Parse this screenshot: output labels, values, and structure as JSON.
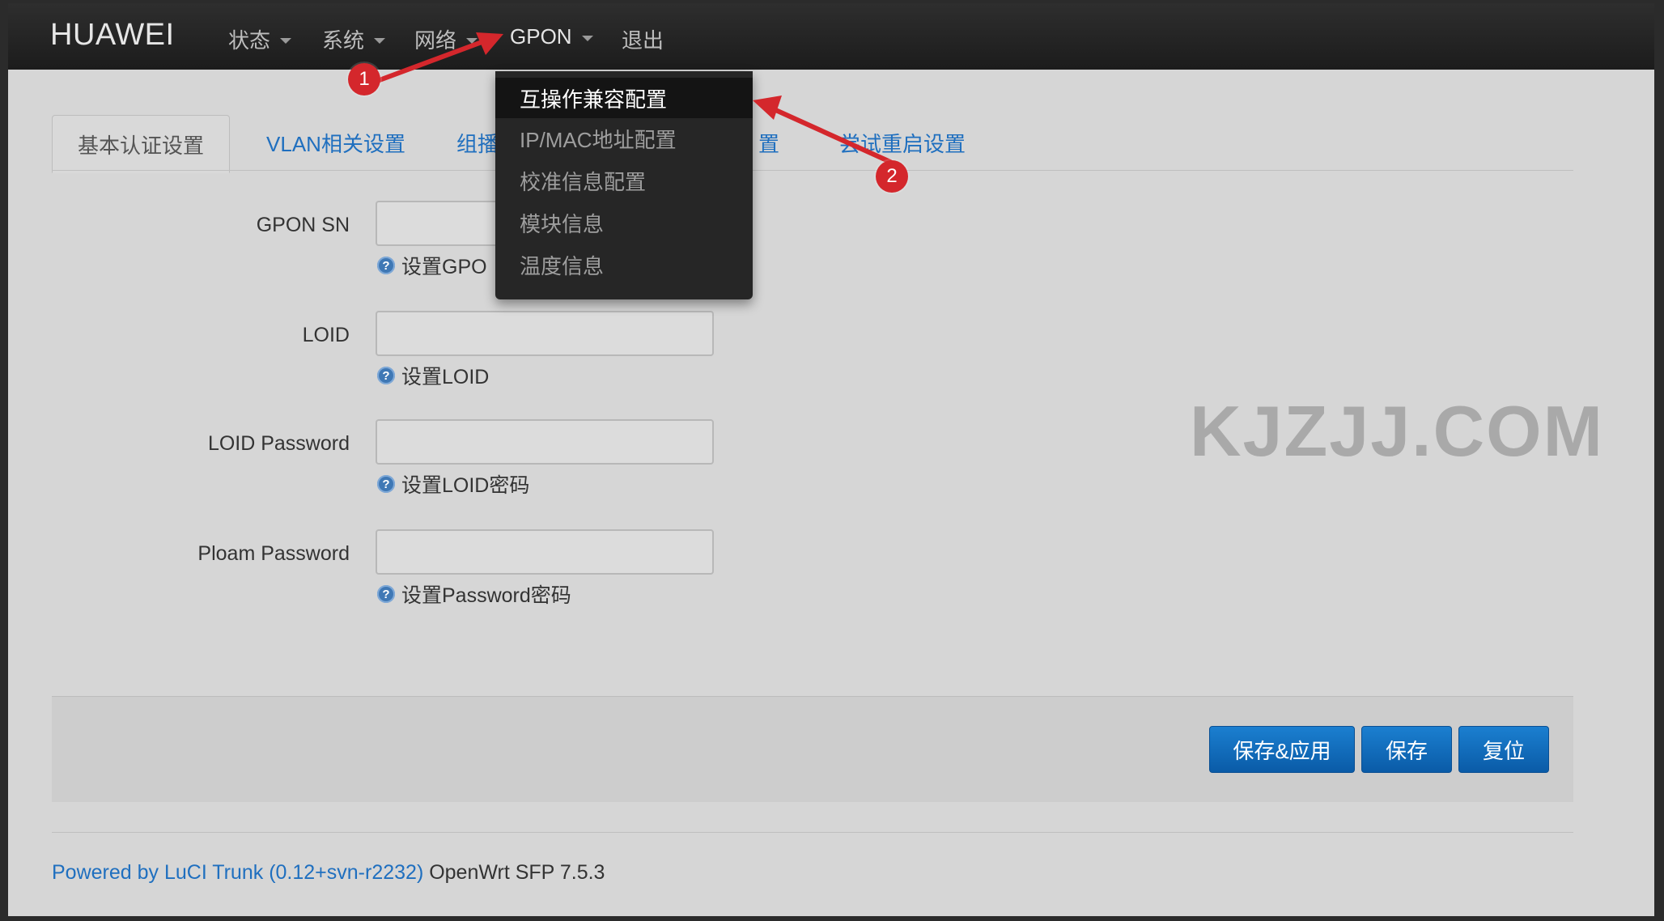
{
  "brand": "HUAWEI",
  "nav": {
    "items": [
      {
        "label": "状态"
      },
      {
        "label": "系统"
      },
      {
        "label": "网络"
      },
      {
        "label": "GPON"
      },
      {
        "label": "退出"
      }
    ]
  },
  "gpon_menu": {
    "items": [
      {
        "label": "互操作兼容配置"
      },
      {
        "label": "IP/MAC地址配置"
      },
      {
        "label": "校准信息配置"
      },
      {
        "label": "模块信息"
      },
      {
        "label": "温度信息"
      }
    ]
  },
  "tabs": [
    {
      "label": "基本认证设置"
    },
    {
      "label": "VLAN相关设置"
    },
    {
      "label": "组播"
    },
    {
      "label": "置"
    },
    {
      "label": "尝试重启设置"
    }
  ],
  "form": {
    "gpon_sn": {
      "label": "GPON SN",
      "value": "",
      "help": "设置GPO"
    },
    "loid": {
      "label": "LOID",
      "value": "",
      "help": "设置LOID"
    },
    "loid_password": {
      "label": "LOID Password",
      "value": "",
      "help": "设置LOID密码"
    },
    "ploam_password": {
      "label": "Ploam Password",
      "value": "",
      "help": "设置Password密码"
    }
  },
  "buttons": {
    "save_apply": "保存&应用",
    "save": "保存",
    "reset": "复位"
  },
  "footer": {
    "link": "Powered by LuCI Trunk (0.12+svn-r2232)",
    "text": " OpenWrt SFP 7.5.3"
  },
  "watermark": "KJZJJ.COM",
  "annotations": {
    "badge1": "1",
    "badge2": "2"
  },
  "colors": {
    "accent": "#1f6fbf",
    "arrow": "#d4272c",
    "navbar": "#1c1c1c"
  }
}
